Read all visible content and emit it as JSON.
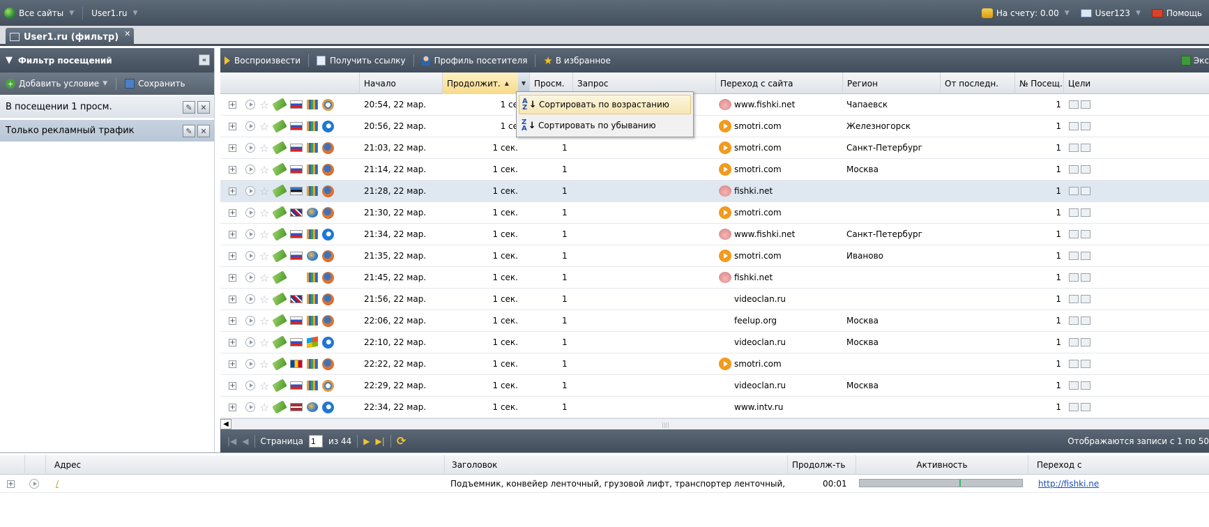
{
  "topbar": {
    "all_sites": "Все сайты",
    "site": "User1.ru",
    "balance": "На счету: 0.00",
    "user": "User123",
    "help": "Помощь"
  },
  "tab": {
    "title": "User1.ru (фильтр)"
  },
  "filter_panel": {
    "title": "Фильтр посещений",
    "add_condition": "Добавить условие",
    "save": "Сохранить",
    "conditions": [
      {
        "label": "В посещении 1 просм.",
        "selected": false
      },
      {
        "label": "Только рекламный трафик",
        "selected": true
      }
    ]
  },
  "grid_toolbar": {
    "play": "Воспроизвести",
    "get_link": "Получить ссылку",
    "profile": "Профиль посетителя",
    "favorites": "В избранное",
    "export": "Экс"
  },
  "columns": {
    "start": "Начало",
    "duration": "Продолжит.",
    "views": "Просм.",
    "query": "Запрос",
    "referrer": "Переход с сайта",
    "region": "Регион",
    "since_last": "От последн.",
    "visit_no": "№ Посещ.",
    "goals": "Цели"
  },
  "sort_menu": {
    "asc": "Сортировать по возрастанию",
    "desc": "Сортировать по убыванию"
  },
  "rows": [
    {
      "start": "20:54, 22 мар.",
      "duration": "1 се",
      "views": "",
      "ref": "www.fishki.net",
      "ref_icon": "pig",
      "region": "Чапаевск",
      "visit": "1",
      "flag": "ru",
      "os": "term",
      "browser": "opera",
      "selected": false
    },
    {
      "start": "20:56, 22 мар.",
      "duration": "1 се",
      "views": "",
      "ref": "smotri.com",
      "ref_icon": "play",
      "region": "Железногорск",
      "visit": "1",
      "flag": "ru",
      "os": "term",
      "browser": "ie",
      "selected": false
    },
    {
      "start": "21:03, 22 мар.",
      "duration": "1 сек.",
      "views": "1",
      "ref": "smotri.com",
      "ref_icon": "play",
      "region": "Санкт-Петербург",
      "visit": "1",
      "flag": "ru",
      "os": "term",
      "browser": "ff",
      "selected": false
    },
    {
      "start": "21:14, 22 мар.",
      "duration": "1 сек.",
      "views": "1",
      "ref": "smotri.com",
      "ref_icon": "play",
      "region": "Москва",
      "visit": "1",
      "flag": "ru",
      "os": "term",
      "browser": "ff",
      "selected": false
    },
    {
      "start": "21:28, 22 мар.",
      "duration": "1 сек.",
      "views": "1",
      "ref": "fishki.net",
      "ref_icon": "pig",
      "region": "",
      "visit": "1",
      "flag": "ee",
      "os": "term",
      "browser": "ff",
      "selected": true
    },
    {
      "start": "21:30, 22 мар.",
      "duration": "1 сек.",
      "views": "1",
      "ref": "smotri.com",
      "ref_icon": "play",
      "region": "",
      "visit": "1",
      "flag": "uk",
      "os": "mac",
      "browser": "ff",
      "selected": false
    },
    {
      "start": "21:34, 22 мар.",
      "duration": "1 сек.",
      "views": "1",
      "ref": "www.fishki.net",
      "ref_icon": "pig",
      "region": "Санкт-Петербург",
      "visit": "1",
      "flag": "ru",
      "os": "term",
      "browser": "ie",
      "selected": false
    },
    {
      "start": "21:35, 22 мар.",
      "duration": "1 сек.",
      "views": "1",
      "ref": "smotri.com",
      "ref_icon": "play",
      "region": "Иваново",
      "visit": "1",
      "flag": "ru",
      "os": "mac",
      "browser": "ff",
      "selected": false
    },
    {
      "start": "21:45, 22 мар.",
      "duration": "1 сек.",
      "views": "1",
      "ref": "fishki.net",
      "ref_icon": "pig",
      "region": "",
      "visit": "1",
      "flag": "",
      "os": "term",
      "browser": "ff",
      "selected": false
    },
    {
      "start": "21:56, 22 мар.",
      "duration": "1 сек.",
      "views": "1",
      "ref": "videoclan.ru",
      "ref_icon": "",
      "region": "",
      "visit": "1",
      "flag": "uk",
      "os": "term",
      "browser": "ff",
      "selected": false
    },
    {
      "start": "22:06, 22 мар.",
      "duration": "1 сек.",
      "views": "1",
      "ref": "feelup.org",
      "ref_icon": "",
      "region": "Москва",
      "visit": "1",
      "flag": "ru",
      "os": "term",
      "browser": "ff",
      "selected": false
    },
    {
      "start": "22:10, 22 мар.",
      "duration": "1 сек.",
      "views": "1",
      "ref": "videoclan.ru",
      "ref_icon": "",
      "region": "Москва",
      "visit": "1",
      "flag": "ru",
      "os": "win",
      "browser": "ie",
      "selected": false
    },
    {
      "start": "22:22, 22 мар.",
      "duration": "1 сек.",
      "views": "1",
      "ref": "smotri.com",
      "ref_icon": "play",
      "region": "",
      "visit": "1",
      "flag": "md",
      "os": "term",
      "browser": "ff",
      "selected": false
    },
    {
      "start": "22:29, 22 мар.",
      "duration": "1 сек.",
      "views": "1",
      "ref": "videoclan.ru",
      "ref_icon": "",
      "region": "Москва",
      "visit": "1",
      "flag": "ru",
      "os": "term",
      "browser": "opera",
      "selected": false
    },
    {
      "start": "22:34, 22 мар.",
      "duration": "1 сек.",
      "views": "1",
      "ref": "www.intv.ru",
      "ref_icon": "",
      "region": "",
      "visit": "1",
      "flag": "lv",
      "os": "mac",
      "browser": "ie",
      "selected": false
    }
  ],
  "pager": {
    "page_label": "Страница",
    "page": "1",
    "of": "из 44",
    "info": "Отображаются записи с 1 по 50"
  },
  "detail": {
    "columns": {
      "address": "Адрес",
      "title": "Заголовок",
      "duration": "Продолж-ть",
      "activity": "Активность",
      "referrer": "Переход с"
    },
    "row": {
      "address": "/",
      "title": "Подъемник, конвейер ленточный, грузовой лифт, транспортер ленточный, с",
      "duration": "00:01",
      "referrer": "http://fishki.ne",
      "activity_marker_fraction": 0.62
    }
  }
}
